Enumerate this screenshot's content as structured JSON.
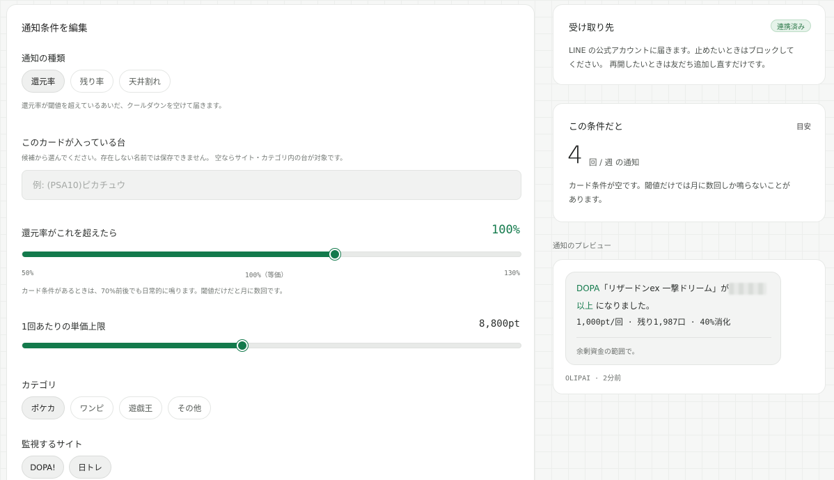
{
  "form": {
    "title": "通知条件を編集",
    "type_section": {
      "label": "通知の種類",
      "options": [
        "還元率",
        "残り率",
        "天井割れ"
      ],
      "selected": "還元率",
      "help": "還元率が閾値を超えているあいだ、クールダウンを空けて届きます。"
    },
    "card_section": {
      "label": "このカードが入っている台",
      "help": "候補から選んでください。存在しない名前では保存できません。 空ならサイト・カテゴリ内の台が対象です。",
      "placeholder": "例: (PSA10)ピカチュウ",
      "value": ""
    },
    "return_rate": {
      "label": "還元率がこれを超えたら",
      "value_text": "100%",
      "value": 100,
      "min": 50,
      "max": 130,
      "ticks": [
        "50%",
        "100%（等価）",
        "130%"
      ],
      "help": "カード条件があるときは、70%前後でも日常的に鳴ります。閾値だけだと月に数回です。"
    },
    "price_limit": {
      "label": "1回あたりの単価上限",
      "value_text": "8,800pt",
      "fill_fraction": 0.44
    },
    "category": {
      "label": "カテゴリ",
      "options": [
        "ポケカ",
        "ワンピ",
        "遊戯王",
        "その他"
      ],
      "selected": "ポケカ"
    },
    "sites": {
      "label": "監視するサイト",
      "options": [
        "DOPA!",
        "日トレ"
      ]
    }
  },
  "destination": {
    "title": "受け取り先",
    "badge": "連携済み",
    "text_line1": "LINE の公式アカウントに届きます。止めたいときはブロックして",
    "text_line2": "ください。 再開したいときは友だち追加し直すだけです。"
  },
  "estimate": {
    "title": "この条件だと",
    "tag": "目安",
    "count": "4",
    "unit": "回 / 週 の通知",
    "note_line1": "カード条件が空です。閾値だけでは月に数回しか鳴らないことが",
    "note_line2": "あります。"
  },
  "preview": {
    "label": "通知のプレビュー",
    "line1_site": "DOPA",
    "line1_rest": "「リザードンex 一撃ドリーム」が",
    "line2_highlight": "以上",
    "line2_rest": " になりました。",
    "stats": "1,000pt/回 · 残り1,987口 · 40%消化",
    "footer": "余剰資金の範囲で。",
    "meta": "OLIPAI · 2分前"
  },
  "colors": {
    "accent": "#137a4c",
    "badge_bg": "#e6f3ea"
  }
}
